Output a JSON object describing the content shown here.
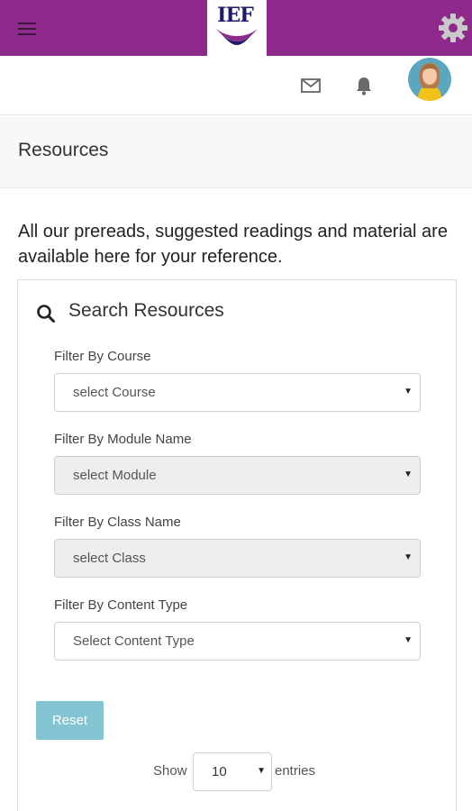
{
  "header": {
    "logo_text": "IEF",
    "brand_color": "#8e2a8c"
  },
  "icons": {
    "menu": "hamburger-icon",
    "settings": "gear-icon",
    "mail": "mail-icon",
    "notifications": "bell-icon",
    "search": "search-icon"
  },
  "page": {
    "title": "Resources",
    "intro": "All our prereads, suggested readings and material are available here for your reference."
  },
  "search_panel": {
    "heading": "Search Resources",
    "filters": [
      {
        "label": "Filter By Course",
        "value": "select Course",
        "disabled": false
      },
      {
        "label": "Filter By Module Name",
        "value": "select Module",
        "disabled": true
      },
      {
        "label": "Filter By Class Name",
        "value": "select Class",
        "disabled": true
      },
      {
        "label": "Filter By Content Type",
        "value": "Select Content Type",
        "disabled": false
      }
    ],
    "reset_label": "Reset",
    "reset_color": "#83c4d2",
    "length": {
      "show_label": "Show",
      "value": "10",
      "entries_label": "entries"
    }
  }
}
